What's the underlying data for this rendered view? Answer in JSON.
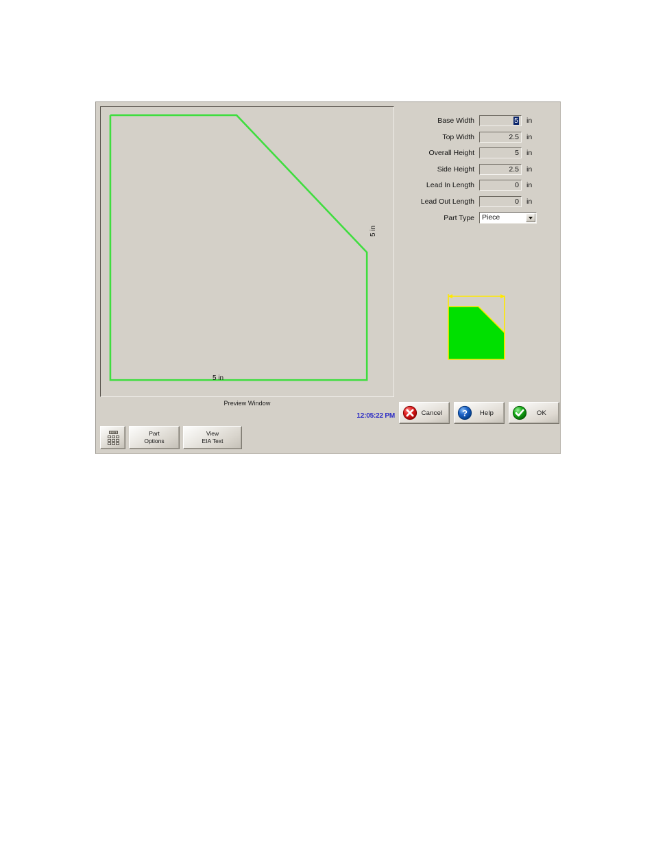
{
  "dialog": {
    "preview": {
      "caption": "Preview Window",
      "clock": "12:05:22 PM",
      "width_dim_label": "5 in",
      "height_dim_label": "5 in",
      "shape_name": "chamfered-corner-part",
      "outline_color": "#3fdd3f",
      "background_color": "#d4d0c8"
    },
    "form": {
      "fields": [
        {
          "label": "Base Width",
          "value": "5",
          "unit": "in",
          "focused": true,
          "name": "base-width"
        },
        {
          "label": "Top Width",
          "value": "2.5",
          "unit": "in",
          "focused": false,
          "name": "top-width"
        },
        {
          "label": "Overall Height",
          "value": "5",
          "unit": "in",
          "focused": false,
          "name": "overall-height"
        },
        {
          "label": "Side Height",
          "value": "2.5",
          "unit": "in",
          "focused": false,
          "name": "side-height"
        },
        {
          "label": "Lead In Length",
          "value": "0",
          "unit": "in",
          "focused": false,
          "name": "lead-in-length"
        },
        {
          "label": "Lead Out Length",
          "value": "0",
          "unit": "in",
          "focused": false,
          "name": "lead-out-length"
        }
      ],
      "part_type": {
        "label": "Part Type",
        "value": "Piece",
        "options": [
          "Piece"
        ]
      }
    },
    "thumbnail": {
      "fill_color": "#00e000",
      "outline_color": "#ffe900",
      "name": "part-thumbnail"
    },
    "tool_buttons": [
      {
        "name": "keypad-button",
        "line1": "",
        "line2": "",
        "icon": "keypad-icon"
      },
      {
        "name": "part-options-button",
        "line1": "Part",
        "line2": "Options",
        "icon": ""
      },
      {
        "name": "view-eia-text-button",
        "line1": "View",
        "line2": "EIA Text",
        "icon": ""
      }
    ],
    "keypad_icon_display": "1234",
    "action_buttons": [
      {
        "name": "cancel-button",
        "label": "Cancel",
        "icon": "cancel-icon",
        "color": "#d81f1f"
      },
      {
        "name": "help-button",
        "label": "Help",
        "icon": "help-icon",
        "color": "#1963c8"
      },
      {
        "name": "ok-button",
        "label": "OK",
        "icon": "ok-icon",
        "color": "#1fb21f"
      }
    ]
  }
}
